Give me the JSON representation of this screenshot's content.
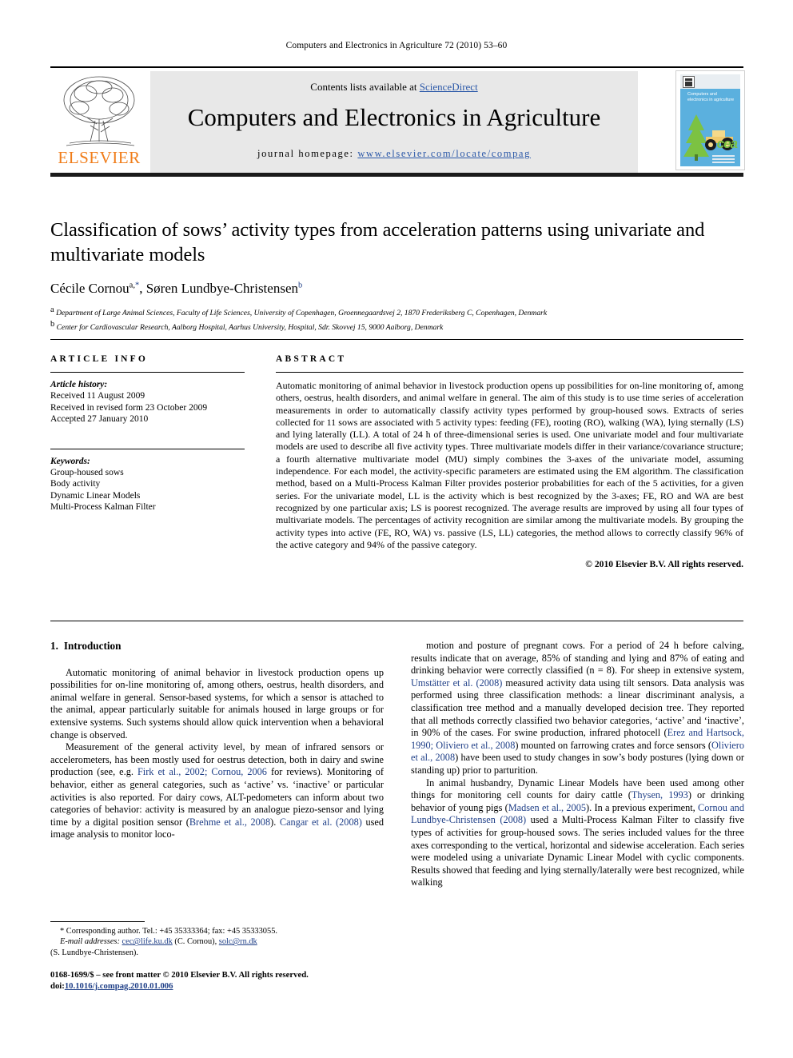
{
  "running_head": "Computers and Electronics in Agriculture 72 (2010) 53–60",
  "banner": {
    "contents_prefix": "Contents lists available at ",
    "sciencedirect": "ScienceDirect",
    "journal_title": "Computers and Electronics in Agriculture",
    "homepage_label": "journal homepage:",
    "homepage_url": "www.elsevier.com/locate/compag",
    "publisher": "ELSEVIER",
    "cover_title": "Computers and electronics in agriculture",
    "cover_mark": "cea"
  },
  "title": "Classification of sows’ activity types from acceleration patterns using univariate and multivariate models",
  "authors": {
    "author1_name": "Cécile Cornou",
    "author1_sup": "a,",
    "author1_star": "*",
    "separator": ", ",
    "author2_name": "Søren Lundbye-Christensen",
    "author2_sup": "b"
  },
  "affiliations": [
    {
      "marker": "a",
      "text": "Department of Large Animal Sciences, Faculty of Life Sciences, University of Copenhagen, Groennegaardsvej 2, 1870 Frederiksberg C, Copenhagen, Denmark"
    },
    {
      "marker": "b",
      "text": "Center for Cardiovascular Research, Aalborg Hospital, Aarhus University, Hospital, Sdr. Skovvej 15, 9000 Aalborg, Denmark"
    }
  ],
  "article_info": {
    "heading": "ARTICLE INFO",
    "history_label": "Article history:",
    "history": [
      "Received 11 August 2009",
      "Received in revised form 23 October 2009",
      "Accepted 27 January 2010"
    ],
    "keywords_label": "Keywords:",
    "keywords": [
      "Group-housed sows",
      "Body activity",
      "Dynamic Linear Models",
      "Multi-Process Kalman Filter"
    ]
  },
  "abstract": {
    "heading": "ABSTRACT",
    "text": "Automatic monitoring of animal behavior in livestock production opens up possibilities for on-line monitoring of, among others, oestrus, health disorders, and animal welfare in general. The aim of this study is to use time series of acceleration measurements in order to automatically classify activity types performed by group-housed sows. Extracts of series collected for 11 sows are associated with 5 activity types: feeding (FE), rooting (RO), walking (WA), lying sternally (LS) and lying laterally (LL). A total of 24 h of three-dimensional series is used. One univariate model and four multivariate models are used to describe all five activity types. Three multivariate models differ in their variance/covariance structure; a fourth alternative multivariate model (MU) simply combines the 3-axes of the univariate model, assuming independence. For each model, the activity-specific parameters are estimated using the EM algorithm. The classification method, based on a Multi-Process Kalman Filter provides posterior probabilities for each of the 5 activities, for a given series. For the univariate model, LL is the activity which is best recognized by the 3-axes; FE, RO and WA are best recognized by one particular axis; LS is poorest recognized. The average results are improved by using all four types of multivariate models. The percentages of activity recognition are similar among the multivariate models. By grouping the activity types into active (FE, RO, WA) vs. passive (LS, LL) categories, the method allows to correctly classify 96% of the active category and 94% of the passive category.",
    "copyright": "© 2010 Elsevier B.V. All rights reserved."
  },
  "section": {
    "number": "1.",
    "title": "Introduction"
  },
  "body": {
    "left": [
      {
        "runs": [
          {
            "t": "Automatic monitoring of animal behavior in livestock production opens up possibilities for on-line monitoring of, among others, oestrus, health disorders, and animal welfare in general. Sensor-based systems, for which a sensor is attached to the animal, appear particularly suitable for animals housed in large groups or for extensive systems. Such systems should allow quick intervention when a behavioral change is observed.",
            "c": false
          }
        ]
      },
      {
        "runs": [
          {
            "t": "Measurement of the general activity level, by mean of infrared sensors or accelerometers, has been mostly used for oestrus detection, both in dairy and swine production (see, e.g. ",
            "c": false
          },
          {
            "t": "Firk et al., 2002;",
            "c": true
          },
          {
            "t": " ",
            "c": false
          },
          {
            "t": "Cornou, 2006",
            "c": true
          },
          {
            "t": " for reviews). Monitoring of behavior, either as general categories, such as ‘active’ vs. ‘inactive’ or particular activities is also reported. For dairy cows, ALT-pedometers can inform about two categories of behavior: activity is measured by an analogue piezo-sensor and lying time by a digital position sensor (",
            "c": false
          },
          {
            "t": "Brehme et al., 2008",
            "c": true
          },
          {
            "t": "). ",
            "c": false
          },
          {
            "t": "Cangar et al. (2008)",
            "c": true
          },
          {
            "t": " used image analysis to monitor loco-",
            "c": false
          }
        ]
      }
    ],
    "right": [
      {
        "runs": [
          {
            "t": "motion and posture of pregnant cows. For a period of 24 h before calving, results indicate that on average, 85% of standing and lying and 87% of eating and drinking behavior were correctly classified (n = 8). For sheep in extensive system, ",
            "c": false
          },
          {
            "t": "Umstätter et al. (2008)",
            "c": true
          },
          {
            "t": " measured activity data using tilt sensors. Data analysis was performed using three classification methods: a linear discriminant analysis, a classification tree method and a manually developed decision tree. They reported that all methods correctly classified two behavior categories, ‘active’ and ‘inactive’, in 90% of the cases. For swine production, infrared photocell (",
            "c": false
          },
          {
            "t": "Erez and Hartsock, 1990; Oliviero et al., 2008",
            "c": true
          },
          {
            "t": ") mounted on farrowing crates and force sensors (",
            "c": false
          },
          {
            "t": "Oliviero et al., 2008",
            "c": true
          },
          {
            "t": ") have been used to study changes in sow’s body postures (lying down or standing up) prior to parturition.",
            "c": false
          }
        ],
        "noindent": false
      },
      {
        "runs": [
          {
            "t": "In animal husbandry, Dynamic Linear Models have been used among other things for monitoring cell counts for dairy cattle (",
            "c": false
          },
          {
            "t": "Thysen, 1993",
            "c": true
          },
          {
            "t": ") or drinking behavior of young pigs (",
            "c": false
          },
          {
            "t": "Madsen et al., 2005",
            "c": true
          },
          {
            "t": "). In a previous experiment, ",
            "c": false
          },
          {
            "t": "Cornou and Lundbye-Christensen (2008)",
            "c": true
          },
          {
            "t": " used a Multi-Process Kalman Filter to classify five types of activities for group-housed sows. The series included values for the three axes corresponding to the vertical, horizontal and sidewise acceleration. Each series were modeled using a univariate Dynamic Linear Model with cyclic components. Results showed that feeding and lying sternally/laterally were best recognized, while walking",
            "c": false
          }
        ]
      }
    ]
  },
  "footnote": {
    "star": "*",
    "corresponding": " Corresponding author. Tel.: +45 35333364; fax: +45 35333055.",
    "email_label": "E-mail addresses:",
    "email1": "cec@life.ku.dk",
    "email1_owner": " (C. Cornou), ",
    "email2": "solc@rn.dk",
    "email2_owner": "(S. Lundbye-Christensen)."
  },
  "imprint": {
    "line1": "0168-1699/$ – see front matter © 2010 Elsevier B.V. All rights reserved.",
    "doi_label": "doi:",
    "doi_value": "10.1016/j.compag.2010.01.006"
  }
}
